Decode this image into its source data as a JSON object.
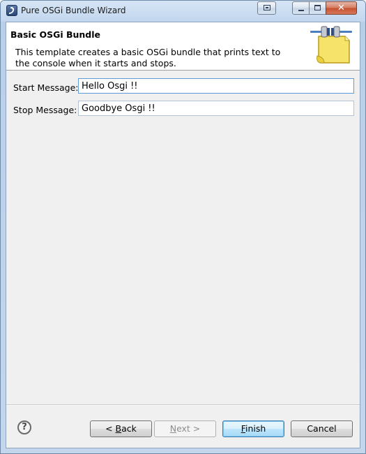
{
  "window": {
    "title": "Pure OSGi Bundle Wizard"
  },
  "header": {
    "title": "Basic OSGi Bundle",
    "description": "This template creates a basic OSGi bundle that prints text to the console when it starts and stops.",
    "image_icon": "plugin-wizard-icon"
  },
  "form": {
    "start_label": "Start Message:",
    "start_value": "Hello Osgi !!",
    "stop_label": "Stop Message:",
    "stop_value": "Goodbye Osgi !!"
  },
  "buttons": {
    "help_glyph": "?",
    "back_prefix": "< ",
    "back_mnemonic": "B",
    "back_rest": "ack",
    "next_mnemonic": "N",
    "next_rest": "ext >",
    "finish_mnemonic": "F",
    "finish_rest": "inish",
    "cancel_label": "Cancel"
  },
  "colors": {
    "default_button_border": "#3c7fb1",
    "dialog_background": "#f0f0f0"
  }
}
